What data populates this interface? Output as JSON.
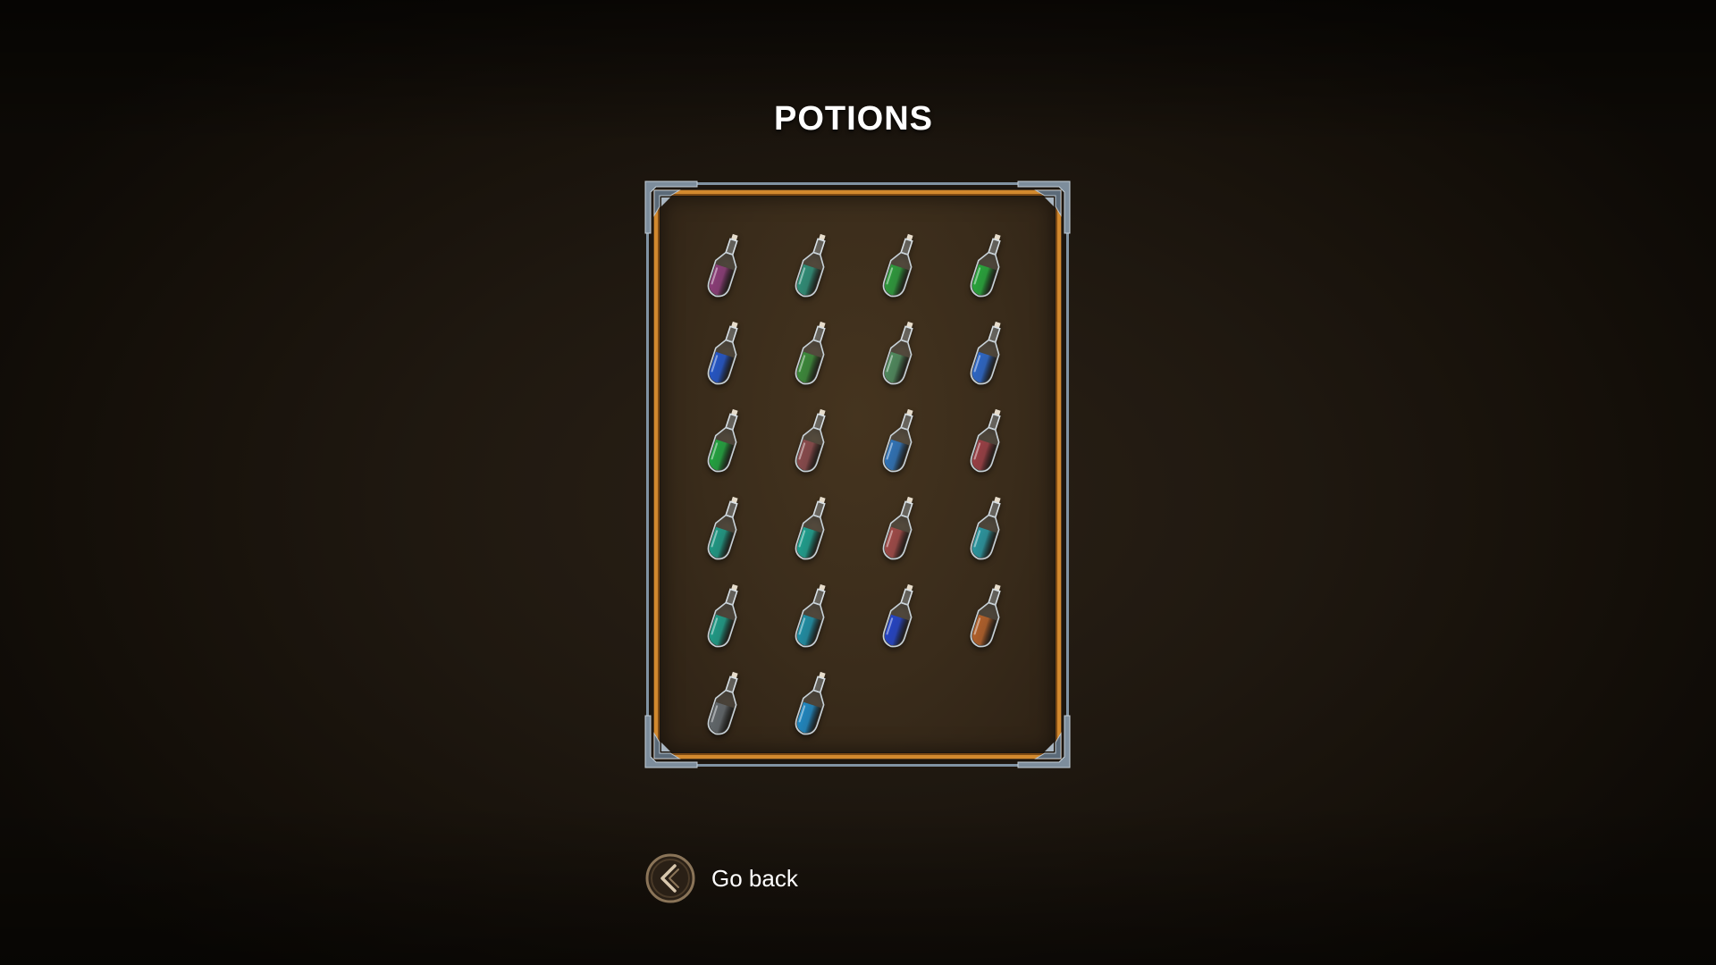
{
  "title": "POTIONS",
  "inventory": {
    "potions": [
      {
        "color": "#8c3d79"
      },
      {
        "color": "#2f8e78"
      },
      {
        "color": "#2d9a3c"
      },
      {
        "color": "#27a53b"
      },
      {
        "color": "#2456c8"
      },
      {
        "color": "#3b8a3a"
      },
      {
        "color": "#4f8a5e"
      },
      {
        "color": "#2c67c8"
      },
      {
        "color": "#22a340"
      },
      {
        "color": "#8a4a4c"
      },
      {
        "color": "#2f73b8"
      },
      {
        "color": "#9a3f45"
      },
      {
        "color": "#1f9a86"
      },
      {
        "color": "#1ea08f"
      },
      {
        "color": "#a04a48"
      },
      {
        "color": "#2a96a0"
      },
      {
        "color": "#1f9c88"
      },
      {
        "color": "#1f8fa6"
      },
      {
        "color": "#2444c6"
      },
      {
        "color": "#b2602a"
      },
      {
        "color": "#62686c"
      },
      {
        "color": "#1f88c2"
      }
    ]
  },
  "back_button": {
    "label": "Go back",
    "icon": "chevron-left-icon"
  },
  "colors": {
    "frame_gold": "#d2892e",
    "frame_steel": "#8193a3",
    "panel_bg": "#3a2c1b",
    "background": "#1f1810",
    "text": "#ffffff"
  }
}
